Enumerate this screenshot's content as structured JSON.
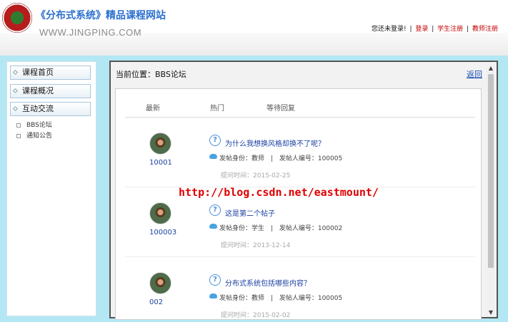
{
  "header": {
    "site_name": "《分布式系统》精品课程网站",
    "site_url": "WWW.JINGPING.COM",
    "login_prompt": "您还未登录!",
    "login_link": "登录",
    "student_register": "学生注册",
    "teacher_register": "教师注册",
    "separator": "|"
  },
  "sidebar": {
    "items": [
      {
        "label": "课程首页",
        "icon": "diamond-bullet-icon"
      },
      {
        "label": "课程概况",
        "icon": "diamond-bullet-icon"
      },
      {
        "label": "互动交流",
        "icon": "diamond-bullet-icon"
      }
    ],
    "sub_items": [
      {
        "label": "BBS论坛"
      },
      {
        "label": "通知公告"
      }
    ]
  },
  "content": {
    "location_label": "当前位置：BBS论坛",
    "back_label": "返回",
    "tabs": [
      "最新",
      "热门",
      "等待回复"
    ],
    "posts": [
      {
        "author_id": "10001",
        "title": "为什么我想换风格却换不了呢？",
        "role_label": "发帖身份：",
        "role": "教师",
        "author_no_label": "发帖人编号：",
        "author_no": "100005",
        "time": "提问时间：2015-02-25"
      },
      {
        "author_id": "100003",
        "title": "这是第二个帖子",
        "role_label": "发帖身份：",
        "role": "学生",
        "author_no_label": "发帖人编号：",
        "author_no": "100002",
        "time": "提问时间：2013-12-14"
      },
      {
        "author_id": "002",
        "title": "分布式系统包括哪些内容？",
        "role_label": "发帖身份：",
        "role": "教师",
        "author_no_label": "发帖人编号：",
        "author_no": "100005",
        "time": "提问时间：2015-02-02"
      }
    ]
  },
  "watermark": "http://blog.csdn.net/eastmount/",
  "colors": {
    "site_title": "#2b6fcf",
    "login_red": "#c00000",
    "page_background": "#b3e7f3",
    "link_blue": "#1a3fa0",
    "watermark_red": "#e00000"
  }
}
